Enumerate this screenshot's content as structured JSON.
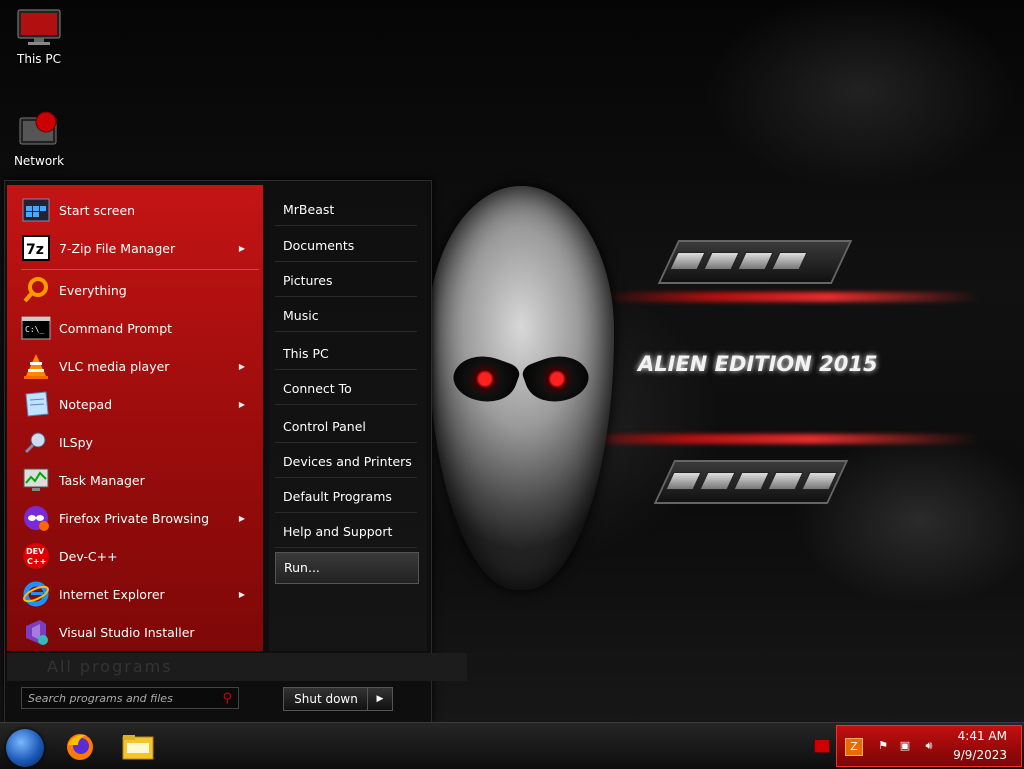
{
  "desktop": {
    "icons": [
      {
        "label": "This PC",
        "icon": "monitor-icon"
      },
      {
        "label": "Network",
        "icon": "network-icon"
      }
    ],
    "wallpaper_text": "ALIEN EDITION 2015"
  },
  "start_menu": {
    "programs": [
      {
        "label": "Start screen",
        "icon": "start-screen-icon",
        "submenu": false
      },
      {
        "label": "7-Zip File Manager",
        "icon": "7zip-icon",
        "submenu": true
      },
      {
        "label": "Everything",
        "icon": "magnifier-icon",
        "submenu": false
      },
      {
        "label": "Command Prompt",
        "icon": "terminal-icon",
        "submenu": false
      },
      {
        "label": "VLC media player",
        "icon": "vlc-cone-icon",
        "submenu": true
      },
      {
        "label": "Notepad",
        "icon": "notepad-icon",
        "submenu": true
      },
      {
        "label": "ILSpy",
        "icon": "ilspy-icon",
        "submenu": false
      },
      {
        "label": "Task Manager",
        "icon": "task-manager-icon",
        "submenu": false
      },
      {
        "label": "Firefox Private Browsing",
        "icon": "firefox-private-icon",
        "submenu": true
      },
      {
        "label": "Dev-C++",
        "icon": "devcpp-icon",
        "submenu": false
      },
      {
        "label": "Internet Explorer",
        "icon": "internet-explorer-icon",
        "submenu": true
      },
      {
        "label": "Visual Studio Installer",
        "icon": "visual-studio-icon",
        "submenu": false
      }
    ],
    "places": [
      {
        "label": "MrBeast"
      },
      {
        "label": "Documents"
      },
      {
        "label": "Pictures"
      },
      {
        "label": "Music"
      },
      {
        "label": "This PC"
      },
      {
        "label": "Connect To"
      },
      {
        "label": "Control Panel"
      },
      {
        "label": "Devices and Printers"
      },
      {
        "label": "Default Programs"
      },
      {
        "label": "Help and Support"
      },
      {
        "label": "Run..."
      }
    ],
    "all_programs_label": "All programs",
    "search_placeholder": "Search programs and files",
    "shutdown_label": "Shut down"
  },
  "taskbar": {
    "pinned": [
      {
        "name": "Firefox",
        "icon": "firefox-icon"
      },
      {
        "name": "File Explorer",
        "icon": "folder-icon"
      }
    ],
    "clock_time": "4:41 AM",
    "clock_date": "9/9/2023"
  },
  "colors": {
    "accent_red": "#c41414",
    "tray_red": "#c20f0f",
    "panel_dark": "#0e0e0e"
  }
}
